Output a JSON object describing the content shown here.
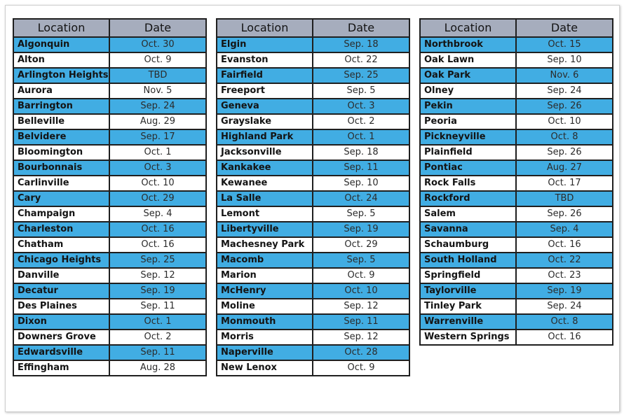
{
  "colors": {
    "header_bg": "#a6adbd",
    "shaded_row_bg": "#41ade3",
    "plain_row_bg": "#ffffff",
    "border": "#1f1f1f"
  },
  "headers": {
    "location": "Location",
    "date": "Date"
  },
  "tables": [
    {
      "rows": [
        {
          "location": "Algonquin",
          "date": "Oct. 30"
        },
        {
          "location": "Alton",
          "date": "Oct. 9"
        },
        {
          "location": "Arlington Heights",
          "date": "TBD"
        },
        {
          "location": "Aurora",
          "date": "Nov. 5"
        },
        {
          "location": "Barrington",
          "date": "Sep. 24"
        },
        {
          "location": "Belleville",
          "date": "Aug. 29"
        },
        {
          "location": "Belvidere",
          "date": "Sep. 17"
        },
        {
          "location": "Bloomington",
          "date": "Oct. 1"
        },
        {
          "location": "Bourbonnais",
          "date": "Oct. 3"
        },
        {
          "location": "Carlinville",
          "date": "Oct. 10"
        },
        {
          "location": "Cary",
          "date": "Oct. 29"
        },
        {
          "location": "Champaign",
          "date": "Sep. 4"
        },
        {
          "location": "Charleston",
          "date": "Oct. 16"
        },
        {
          "location": "Chatham",
          "date": "Oct. 16"
        },
        {
          "location": "Chicago Heights",
          "date": "Sep. 25"
        },
        {
          "location": "Danville",
          "date": "Sep. 12"
        },
        {
          "location": "Decatur",
          "date": "Sep. 19"
        },
        {
          "location": "Des Plaines",
          "date": "Sep. 11"
        },
        {
          "location": "Dixon",
          "date": "Oct. 1"
        },
        {
          "location": "Downers Grove",
          "date": "Oct. 2"
        },
        {
          "location": "Edwardsville",
          "date": "Sep. 11"
        },
        {
          "location": "Effingham",
          "date": "Aug. 28"
        }
      ]
    },
    {
      "rows": [
        {
          "location": "Elgin",
          "date": "Sep. 18"
        },
        {
          "location": "Evanston",
          "date": "Oct. 22"
        },
        {
          "location": "Fairfield",
          "date": "Sep. 25"
        },
        {
          "location": "Freeport",
          "date": "Sep. 5"
        },
        {
          "location": "Geneva",
          "date": "Oct. 3"
        },
        {
          "location": "Grayslake",
          "date": "Oct. 2"
        },
        {
          "location": "Highland Park",
          "date": "Oct. 1"
        },
        {
          "location": "Jacksonville",
          "date": "Sep. 18"
        },
        {
          "location": "Kankakee",
          "date": "Sep. 11"
        },
        {
          "location": "Kewanee",
          "date": "Sep. 10"
        },
        {
          "location": "La Salle",
          "date": "Oct. 24"
        },
        {
          "location": "Lemont",
          "date": "Sep. 5"
        },
        {
          "location": "Libertyville",
          "date": "Sep. 19"
        },
        {
          "location": "Machesney Park",
          "date": "Oct. 29"
        },
        {
          "location": "Macomb",
          "date": "Sep. 5"
        },
        {
          "location": "Marion",
          "date": "Oct. 9"
        },
        {
          "location": "McHenry",
          "date": "Oct. 10"
        },
        {
          "location": "Moline",
          "date": "Sep. 12"
        },
        {
          "location": "Monmouth",
          "date": "Sep. 11"
        },
        {
          "location": "Morris",
          "date": "Sep. 12"
        },
        {
          "location": "Naperville",
          "date": "Oct. 28"
        },
        {
          "location": "New Lenox",
          "date": "Oct. 9"
        }
      ]
    },
    {
      "rows": [
        {
          "location": "Northbrook",
          "date": "Oct. 15"
        },
        {
          "location": "Oak Lawn",
          "date": "Sep. 10"
        },
        {
          "location": "Oak Park",
          "date": "Nov. 6"
        },
        {
          "location": "Olney",
          "date": "Sep. 24"
        },
        {
          "location": "Pekin",
          "date": "Sep. 26"
        },
        {
          "location": "Peoria",
          "date": "Oct. 10"
        },
        {
          "location": "Pickneyville",
          "date": "Oct. 8"
        },
        {
          "location": "Plainfield",
          "date": "Sep. 26"
        },
        {
          "location": "Pontiac",
          "date": "Aug. 27"
        },
        {
          "location": "Rock Falls",
          "date": "Oct. 17"
        },
        {
          "location": "Rockford",
          "date": "TBD"
        },
        {
          "location": "Salem",
          "date": "Sep. 26"
        },
        {
          "location": "Savanna",
          "date": "Sep. 4"
        },
        {
          "location": "Schaumburg",
          "date": "Oct. 16"
        },
        {
          "location": "South Holland",
          "date": "Oct. 22"
        },
        {
          "location": "Springfield",
          "date": "Oct. 23"
        },
        {
          "location": "Taylorville",
          "date": "Sep. 19"
        },
        {
          "location": "Tinley Park",
          "date": "Sep. 24"
        },
        {
          "location": "Warrenville",
          "date": "Oct. 8"
        },
        {
          "location": "Western Springs",
          "date": "Oct. 16"
        }
      ]
    }
  ]
}
